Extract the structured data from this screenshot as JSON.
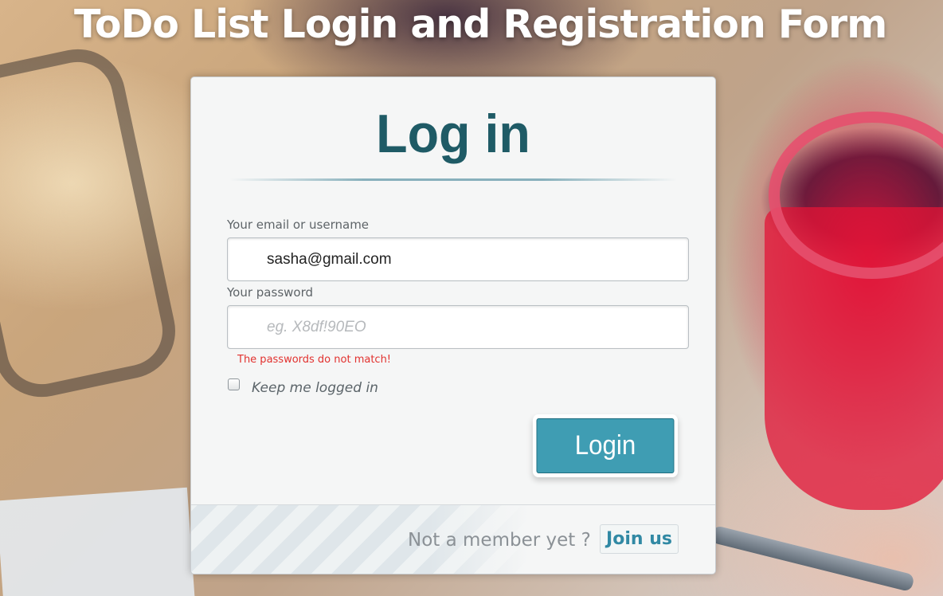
{
  "page": {
    "title": "ToDo List Login and Registration Form"
  },
  "login_form": {
    "heading": "Log in",
    "email": {
      "label": "Your email or username",
      "value": "sasha@gmail.com"
    },
    "password": {
      "label": "Your password",
      "value": "",
      "placeholder": "eg. X8df!90EO",
      "error": "The passwords do not match!"
    },
    "keep_logged_in": {
      "label": "Keep me logged in",
      "checked": false
    },
    "submit_label": "Login"
  },
  "footer": {
    "prompt": "Not a member yet ?",
    "join_label": "Join us"
  },
  "colors": {
    "accent": "#3f9db3",
    "heading": "#1f5b66",
    "error": "#e2322f",
    "link": "#3189a4"
  }
}
